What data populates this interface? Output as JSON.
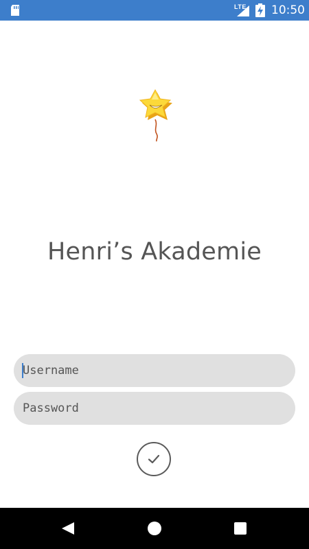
{
  "status_bar": {
    "time": "10:50",
    "network": "LTE",
    "background_color": "#3d7ecb",
    "icons": [
      "sd-card-icon",
      "signal-icon",
      "battery-charging-icon"
    ]
  },
  "app": {
    "title": "Henri’s Akademie",
    "logo": "star-balloon-logo"
  },
  "login_form": {
    "username_placeholder": "Username",
    "password_placeholder": "Password",
    "submit_icon": "checkmark-icon"
  },
  "nav_bar": {
    "icons": [
      "back-icon",
      "home-icon",
      "recents-icon"
    ]
  }
}
